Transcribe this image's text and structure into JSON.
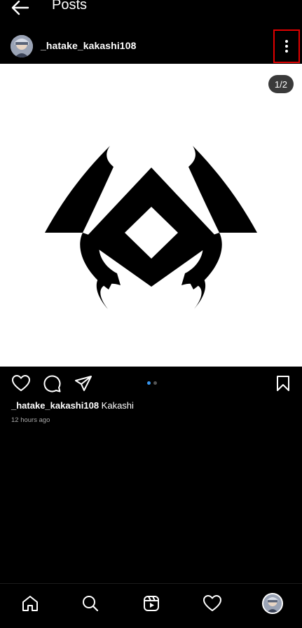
{
  "topbar": {
    "title": "Posts",
    "back_icon": "arrow-left-icon"
  },
  "post": {
    "username": "_hatake_kakashi108",
    "image_counter": "1/2",
    "caption_user": "_hatake_kakashi108",
    "caption_text": "Kakashi",
    "timestamp": "12 hours ago",
    "carousel": {
      "total": 2,
      "active": 1
    }
  },
  "colors": {
    "background": "#000000",
    "highlight_box": "#e00000",
    "carousel_active": "#3897f0",
    "carousel_inactive": "#555555",
    "timestamp": "#a8a8a8"
  },
  "actions": [
    "heart-icon",
    "comment-icon",
    "share-icon",
    "bookmark-icon"
  ],
  "bottom_nav": [
    "home-icon",
    "search-icon",
    "reels-icon",
    "heart-icon",
    "profile-avatar"
  ]
}
